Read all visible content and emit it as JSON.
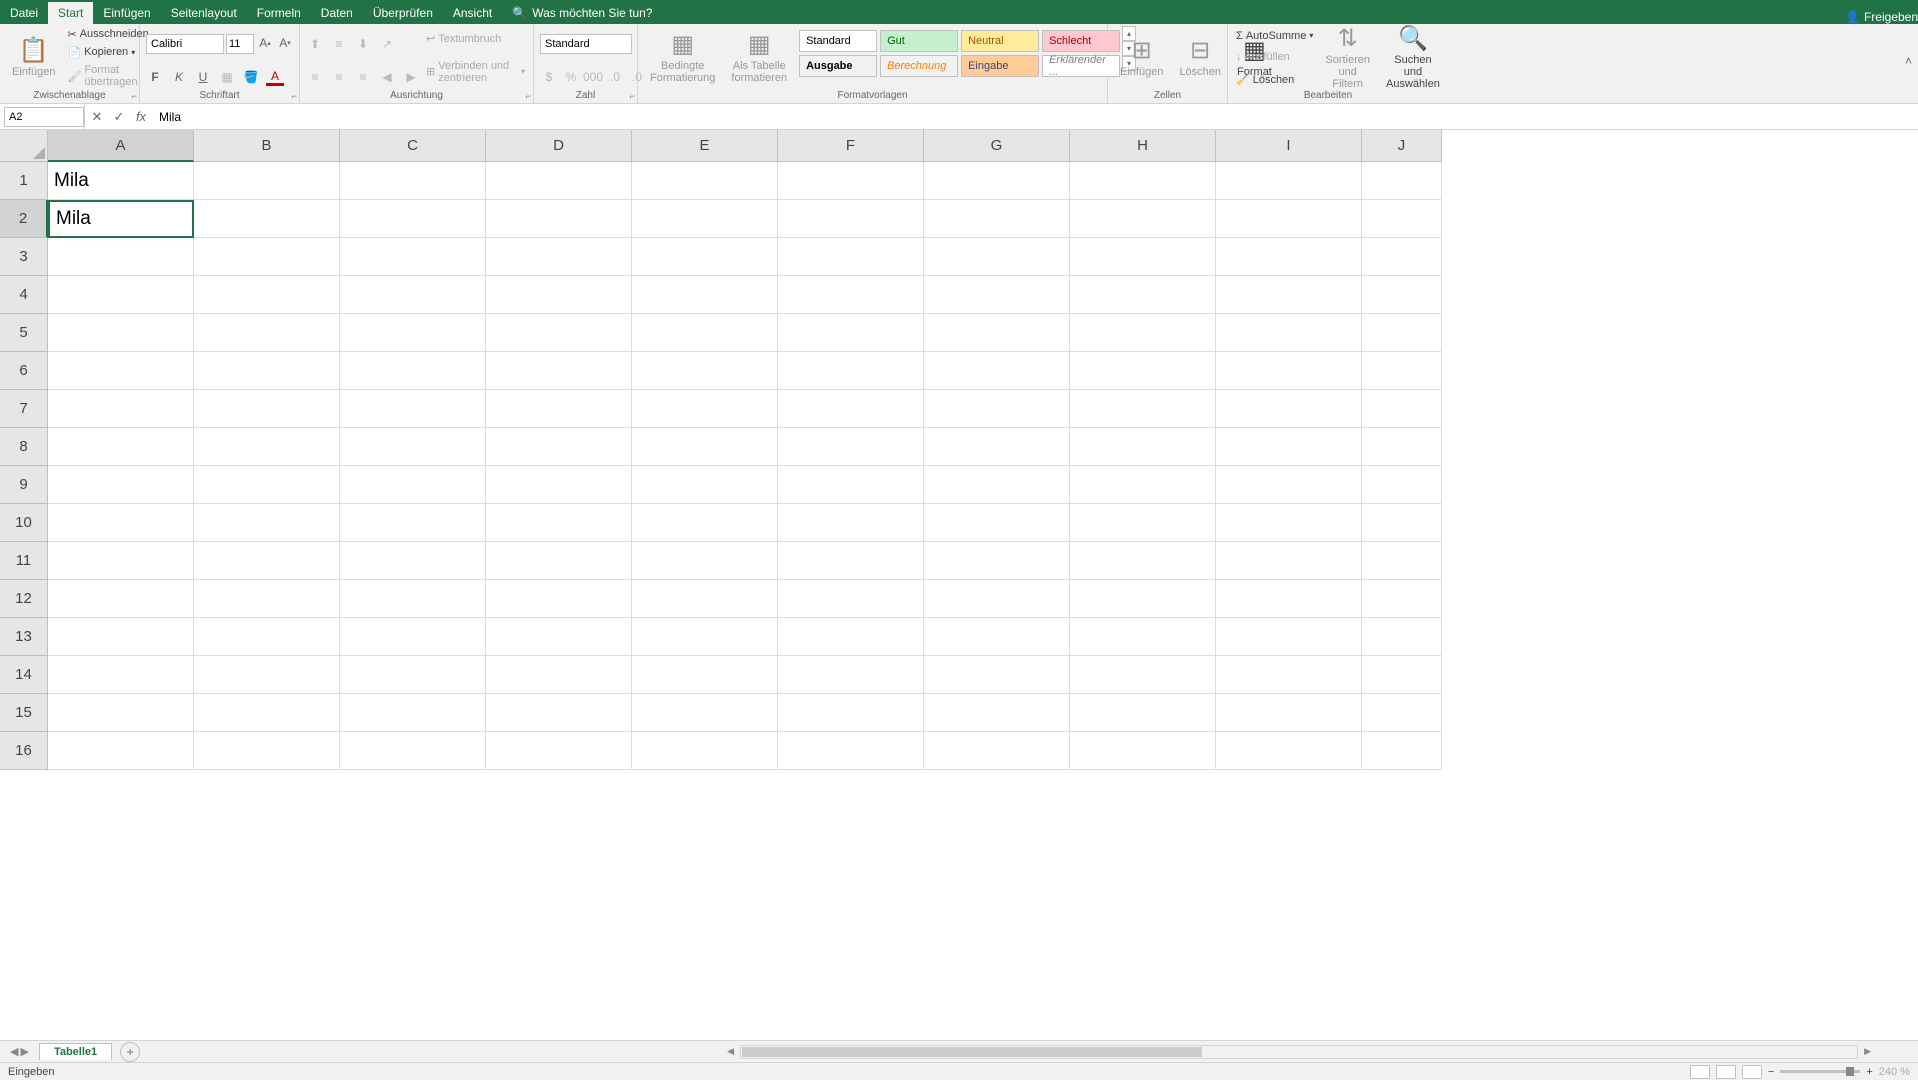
{
  "tabs": {
    "datei": "Datei",
    "start": "Start",
    "einfuegen": "Einfügen",
    "seitenlayout": "Seitenlayout",
    "formeln": "Formeln",
    "daten": "Daten",
    "ueberpruefen": "Überprüfen",
    "ansicht": "Ansicht",
    "tellme": "Was möchten Sie tun?"
  },
  "share": "Freigeben",
  "clipboard": {
    "label": "Zwischenablage",
    "paste": "Einfügen",
    "cut": "Ausschneiden",
    "copy": "Kopieren",
    "format_painter": "Format übertragen"
  },
  "font": {
    "label": "Schriftart",
    "name": "Calibri",
    "size": "11"
  },
  "alignment": {
    "label": "Ausrichtung",
    "wrap": "Textumbruch",
    "merge": "Verbinden und zentrieren"
  },
  "number": {
    "label": "Zahl",
    "format": "Standard"
  },
  "styles": {
    "label": "Formatvorlagen",
    "conditional1": "Bedingte",
    "conditional2": "Formatierung",
    "table1": "Als Tabelle",
    "table2": "formatieren",
    "standard": "Standard",
    "gut": "Gut",
    "neutral": "Neutral",
    "schlecht": "Schlecht",
    "ausgabe": "Ausgabe",
    "berechnung": "Berechnung",
    "eingabe": "Eingabe",
    "erklarend": "Erklärender ..."
  },
  "cells": {
    "label": "Zellen",
    "insert": "Einfügen",
    "delete": "Löschen",
    "format": "Format"
  },
  "editing": {
    "label": "Bearbeiten",
    "autosum": "AutoSumme",
    "fill": "Ausfüllen",
    "clear": "Löschen",
    "sort1": "Sortieren und",
    "sort2": "Filtern",
    "find1": "Suchen und",
    "find2": "Auswählen"
  },
  "namebox": "A2",
  "formula": "Mila",
  "columns": [
    "A",
    "B",
    "C",
    "D",
    "E",
    "F",
    "G",
    "H",
    "I",
    "J"
  ],
  "rows": [
    "1",
    "2",
    "3",
    "4",
    "5",
    "6",
    "7",
    "8",
    "9",
    "10",
    "11",
    "12",
    "13",
    "14",
    "15",
    "16"
  ],
  "cell_a1": "Mila",
  "cell_a2": "Mila",
  "sheet": "Tabelle1",
  "status": "Eingeben",
  "zoom": "240 %"
}
